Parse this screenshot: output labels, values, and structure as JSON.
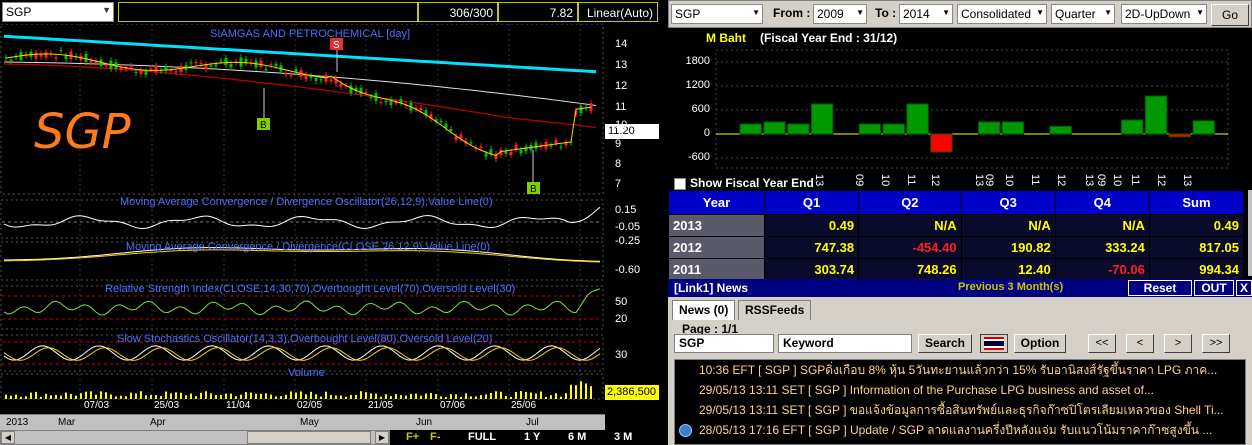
{
  "chart": {
    "symbol": "SGP",
    "range": "306/300",
    "last": "7.82",
    "scale": "Linear(Auto)",
    "title": "SIAMGAS AND PETROCHEMICAL [day]",
    "big_symbol": "SGP",
    "price_tag": "11.20",
    "volume_tag": "2,386,500",
    "price_axis": [
      "14",
      "13",
      "12",
      "11",
      "10",
      "9",
      "8",
      "7"
    ],
    "macd1_title": "Moving Average Convergence / Divergence Oscillator(26,12,9),Value Line(0)",
    "macd1_axis": [
      "0.15",
      "-0.05",
      "-0.25"
    ],
    "macd2_title": "Moving Average Convergence / Divergence(CLOSE,26,12,9),Value Line(0)",
    "macd2_axis": [
      "-0.60"
    ],
    "rsi_title": "Relative Strength Index(CLOSE,14,30,70),Overbought Level(70),Oversold Level(30)",
    "rsi_axis": [
      "50",
      "20"
    ],
    "stoch_title": "Slow Stochastics Oscillator(14,3,3),Overbought Level(80),Oversold Level(20)",
    "stoch_axis": [
      "30"
    ],
    "volume_title": "Volume",
    "signals": [
      "S",
      "B",
      "B"
    ],
    "dates": [
      "07/03",
      "25/03",
      "11/04",
      "02/05",
      "21/05",
      "07/06",
      "25/06"
    ],
    "months": [
      "2013",
      "Mar",
      "Apr",
      "May",
      "Jun",
      "Jul"
    ],
    "zoom": [
      "F+",
      "F-",
      "FULL",
      "1 Y",
      "6 M",
      "3 M"
    ]
  },
  "financial": {
    "symbol": "SGP",
    "from_label": "From :",
    "from": "2009",
    "to_label": "To :",
    "to": "2014",
    "mode": "Consolidated",
    "period": "Quarter",
    "view": "2D-UpDown",
    "go": "Go",
    "unit": "M Baht",
    "fiscal": "(Fiscal Year End : 31/12)",
    "show_fiscal": "Show Fiscal Year End",
    "y_axis": [
      "1800",
      "1200",
      "600",
      "0",
      "-600"
    ],
    "x_labels": [
      "13",
      "09",
      "10",
      "11",
      "12",
      "13",
      "09",
      "10",
      "11",
      "12",
      "13",
      "09",
      "10",
      "11",
      "12",
      "13"
    ],
    "bars": [
      250,
      300,
      250,
      750,
      0,
      250,
      250,
      750,
      -450,
      0,
      300,
      300,
      0,
      190,
      0,
      0,
      350,
      950,
      -70,
      330
    ],
    "columns": [
      "Year",
      "Q1",
      "Q2",
      "Q3",
      "Q4",
      "Sum"
    ],
    "rows": [
      {
        "year": "2013",
        "q1": "0.49",
        "q2": "N/A",
        "q3": "N/A",
        "q4": "N/A",
        "sum": "0.49"
      },
      {
        "year": "2012",
        "q1": "747.38",
        "q2": "-454.40",
        "q3": "190.82",
        "q4": "333.24",
        "sum": "817.05"
      },
      {
        "year": "2011",
        "q1": "303.74",
        "q2": "748.26",
        "q3": "12.40",
        "q4": "-70.06",
        "sum": "994.34"
      }
    ]
  },
  "news": {
    "link": "[Link1] News",
    "previous": "Previous 3 Month(s)",
    "reset": "Reset",
    "out": "OUT",
    "x": "X",
    "tab_news": "News (0)",
    "tab_rss": "RSSFeeds",
    "page": "Page : 1/1",
    "symbol_value": "SGP",
    "keyword_value": "Keyword",
    "search": "Search",
    "option": "Option",
    "nav": [
      "<<",
      "<",
      ">",
      ">>"
    ],
    "items": [
      "10:36  EFT  [ SGP ]  SGPดิ่งเกือบ 8% หุ้น 5วันทะยานแล้วกว่า 15% รับอานิสงส์รัฐขึ้นราคา LPG ภาค...",
      "29/05/13 13:11  SET  [ SGP ]  Information  of the Purchase  LPG business and asset of...",
      "29/05/13 13:11  SET  [ SGP ]  ขอแจ้งข้อมูลการซื้อสินทรัพย์และธุรกิจก๊าซปิโตรเลียมเหลวของ Shell Ti...",
      "28/05/13 17:16  EFT  [ SGP ]  Update / SGP ลาดแลงานครึ่งปีหลังแจ่ม รับแนวโน้มราคาก๊าซสูงขึ้น ..."
    ]
  },
  "colors": {
    "accent_blue": "#0000c8",
    "up_green": "#00c000",
    "down_red": "#ff0000",
    "news_text": "#ffd28a"
  }
}
